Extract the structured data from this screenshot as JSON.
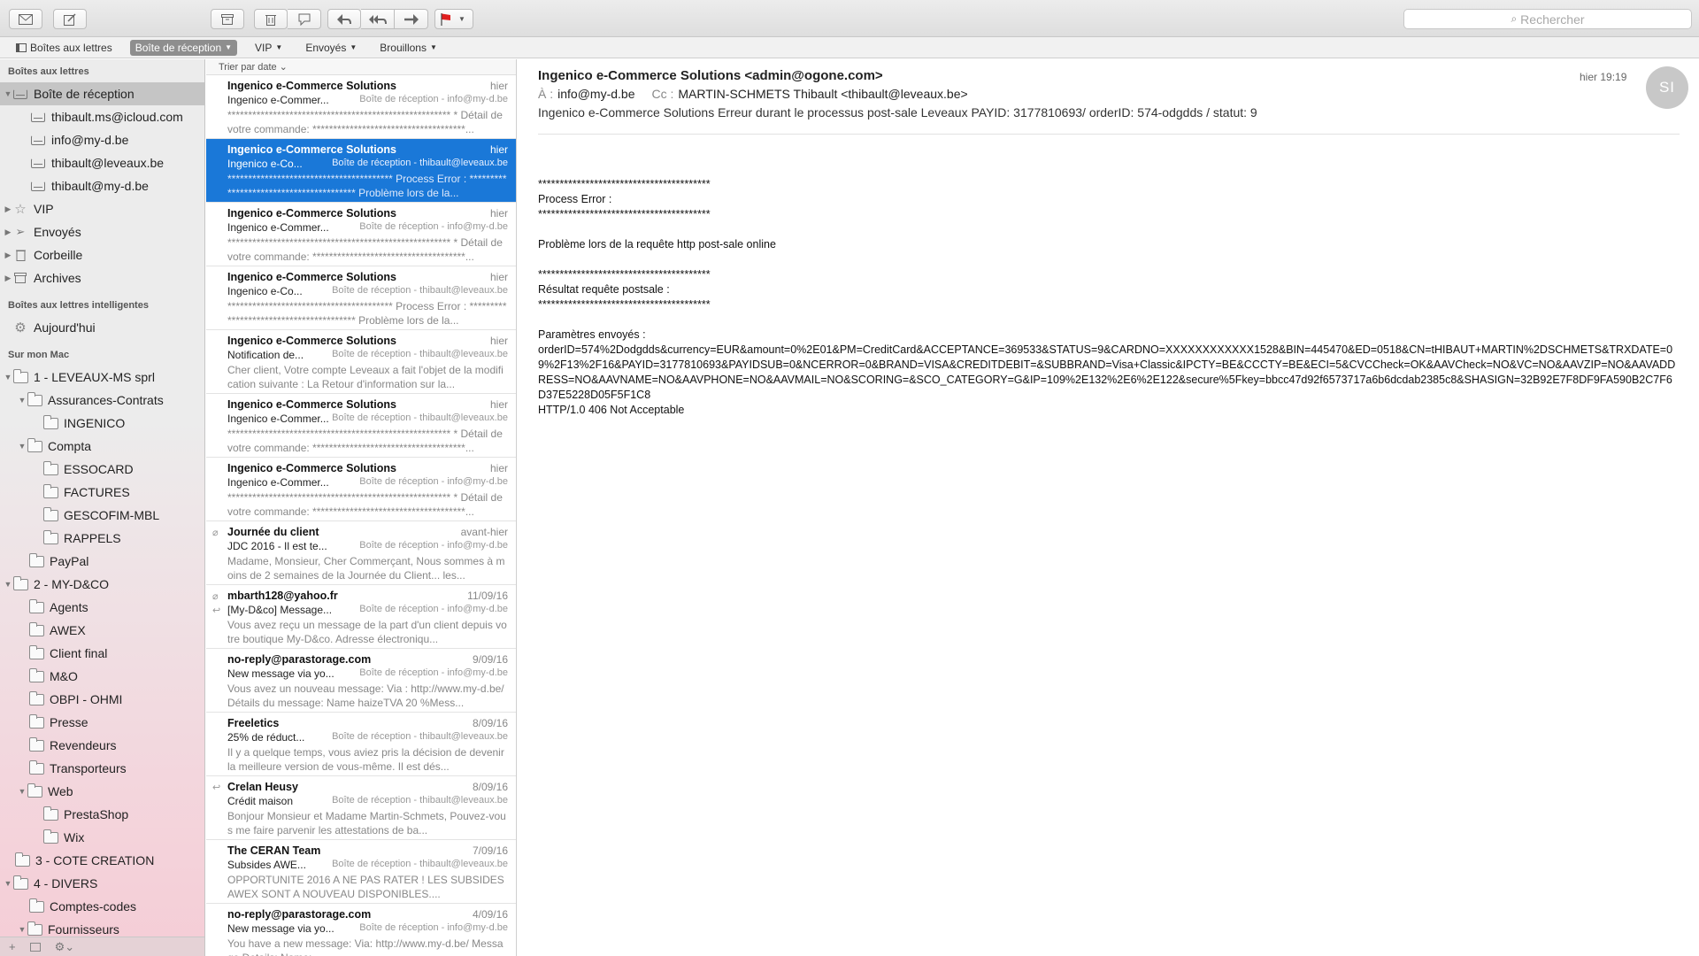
{
  "toolbar": {
    "buttons": [
      {
        "name": "get-mail",
        "icon": "envelope-icon"
      },
      {
        "name": "compose",
        "icon": "compose-icon"
      },
      {
        "name": "archive",
        "icon": "archive-icon"
      },
      {
        "name": "delete",
        "icon": "trash-icon"
      },
      {
        "name": "junk",
        "icon": "junk-icon"
      },
      {
        "name": "reply",
        "icon": "reply-icon"
      },
      {
        "name": "reply-all",
        "icon": "reply-all-icon"
      },
      {
        "name": "forward",
        "icon": "forward-icon"
      },
      {
        "name": "flag",
        "icon": "flag-icon"
      }
    ],
    "search_placeholder": "Rechercher",
    "flag_color": "#e02020"
  },
  "favorites": {
    "mailboxes": "Boîtes aux lettres",
    "inbox": "Boîte de réception",
    "vip": "VIP",
    "sent": "Envoyés",
    "drafts": "Brouillons"
  },
  "sidebar": {
    "section_mailboxes": "Boîtes aux lettres",
    "inbox": "Boîte de réception",
    "accounts": [
      "thibault.ms@icloud.com",
      "info@my-d.be",
      "thibault@leveaux.be",
      "thibault@my-d.be"
    ],
    "vip": "VIP",
    "sent": "Envoyés",
    "trash": "Corbeille",
    "archives": "Archives",
    "section_smart": "Boîtes aux lettres intelligentes",
    "today": "Aujourd'hui",
    "section_mac": "Sur mon Mac",
    "folders": {
      "f1": "1 - LEVEAUX-MS sprl",
      "assurances": "Assurances-Contrats",
      "ingenico": "INGENICO",
      "compta": "Compta",
      "essocard": "ESSOCARD",
      "factures": "FACTURES",
      "gescofim": "GESCOFIM-MBL",
      "rappels": "RAPPELS",
      "paypal": "PayPal",
      "f2": "2 - MY-D&CO",
      "agents": "Agents",
      "awex": "AWEX",
      "client_final": "Client final",
      "mo": "M&O",
      "obpi": "OBPI - OHMI",
      "presse": "Presse",
      "revendeurs": "Revendeurs",
      "transporteurs": "Transporteurs",
      "web": "Web",
      "prestashop": "PrestaShop",
      "wix": "Wix",
      "f3": "3 - COTE CREATION",
      "f4": "4 - DIVERS",
      "comptes_codes": "Comptes-codes",
      "fournisseurs": "Fournisseurs"
    },
    "bottom": {
      "add": "+",
      "gear": "⚙⌄"
    }
  },
  "list": {
    "sort_label": "Trier par date ⌄",
    "messages": [
      {
        "sender": "Ingenico e-Commerce Solutions",
        "date": "hier",
        "subject": "Ingenico e-Commer...",
        "mailbox": "Boîte de réception - info@my-d.be",
        "preview": "****************************************************** * Détail de votre commande: *************************************..."
      },
      {
        "sender": "Ingenico e-Commerce Solutions",
        "date": "hier",
        "subject": "Ingenico e-Co...",
        "mailbox": "Boîte de réception - thibault@leveaux.be",
        "preview": "**************************************** Process Error : **************************************** Problème lors de la..."
      },
      {
        "sender": "Ingenico e-Commerce Solutions",
        "date": "hier",
        "subject": "Ingenico e-Commer...",
        "mailbox": "Boîte de réception - info@my-d.be",
        "preview": "****************************************************** * Détail de votre commande: *************************************..."
      },
      {
        "sender": "Ingenico e-Commerce Solutions",
        "date": "hier",
        "subject": "Ingenico e-Co...",
        "mailbox": "Boîte de réception - thibault@leveaux.be",
        "preview": "**************************************** Process Error : **************************************** Problème lors de la..."
      },
      {
        "sender": "Ingenico e-Commerce Solutions",
        "date": "hier",
        "subject": "Notification de...",
        "mailbox": "Boîte de réception - thibault@leveaux.be",
        "preview": "Cher client, Votre compte Leveaux a fait l'objet de la modification suivante : La Retour d'information sur la..."
      },
      {
        "sender": "Ingenico e-Commerce Solutions",
        "date": "hier",
        "subject": "Ingenico e-Commer...",
        "mailbox": "Boîte de réception - thibault@leveaux.be",
        "preview": "****************************************************** * Détail de votre commande: *************************************..."
      },
      {
        "sender": "Ingenico e-Commerce Solutions",
        "date": "hier",
        "subject": "Ingenico e-Commer...",
        "mailbox": "Boîte de réception - info@my-d.be",
        "preview": "****************************************************** * Détail de votre commande: *************************************..."
      },
      {
        "sender": "Journée du client",
        "date": "avant-hier",
        "subject": "JDC 2016 - Il est te...",
        "mailbox": "Boîte de réception - info@my-d.be",
        "preview": "Madame, Monsieur, Cher Commerçant, Nous sommes à moins de 2 semaines de la Journée du Client... les..."
      },
      {
        "sender": "mbarth128@yahoo.fr",
        "date": "11/09/16",
        "subject": "[My-D&co] Message...",
        "mailbox": "Boîte de réception - info@my-d.be",
        "preview": "Vous avez reçu un message de la part d'un client depuis votre boutique My-D&co. Adresse électroniqu..."
      },
      {
        "sender": "no-reply@parastorage.com",
        "date": "9/09/16",
        "subject": "New message via yo...",
        "mailbox": "Boîte de réception - info@my-d.be",
        "preview": "Vous avez un nouveau message: Via : http://www.my-d.be/Détails du message: Name haizeTVA 20 %Mess..."
      },
      {
        "sender": "Freeletics",
        "date": "8/09/16",
        "subject": "25% de réduct...",
        "mailbox": "Boîte de réception - thibault@leveaux.be",
        "preview": "Il y a quelque temps, vous aviez pris la décision de devenir la meilleure version de vous-même. Il est dés..."
      },
      {
        "sender": "Crelan Heusy",
        "date": "8/09/16",
        "subject": "Crédit maison",
        "mailbox": "Boîte de réception - thibault@leveaux.be",
        "preview": "Bonjour Monsieur et Madame Martin-Schmets, Pouvez-vous me faire parvenir les attestations de ba..."
      },
      {
        "sender": "The CERAN Team",
        "date": "7/09/16",
        "subject": "Subsides AWE...",
        "mailbox": "Boîte de réception - thibault@leveaux.be",
        "preview": "OPPORTUNITE 2016 A NE PAS RATER ! LES SUBSIDES AWEX SONT A NOUVEAU DISPONIBLES...."
      },
      {
        "sender": "no-reply@parastorage.com",
        "date": "4/09/16",
        "subject": "New message via yo...",
        "mailbox": "Boîte de réception - info@my-d.be",
        "preview": "You have a new message: Via: http://www.my-d.be/ Message Details: Name: ..."
      }
    ]
  },
  "reader": {
    "from": "Ingenico e-Commerce Solutions <admin@ogone.com>",
    "to_label": "À :",
    "to": "info@my-d.be",
    "cc_label": "Cc :",
    "cc": "MARTIN-SCHMETS Thibault <thibault@leveaux.be>",
    "subject": "Ingenico e-Commerce Solutions Erreur durant le processus post-sale Leveaux PAYID: 3177810693/ orderID: 574-odgdds / statut: 9",
    "time": "hier 19:19",
    "avatar_initials": "SI",
    "body": [
      "****************************************",
      "Process Error :",
      "****************************************",
      "",
      "Problème lors de la requête http post-sale online",
      "",
      "****************************************",
      "Résultat requête postsale :",
      "****************************************",
      "",
      "Paramètres envoyés :",
      "orderID=574%2Dodgdds&currency=EUR&amount=0%2E01&PM=CreditCard&ACCEPTANCE=369533&STATUS=9&CARDNO=XXXXXXXXXXXX1528&BIN=445470&ED=0518&CN=tHIBAUT+MARTIN%2DSCHMETS&TRXDATE=09%2F13%2F16&PAYID=3177810693&PAYIDSUB=0&NCERROR=0&BRAND=VISA&CREDITDEBIT=&SUBBRAND=Visa+Classic&IPCTY=BE&CCCTY=BE&ECI=5&CVCCheck=OK&AAVCheck=NO&VC=NO&AAVZIP=NO&AAVADDRESS=NO&AAVNAME=NO&AAVPHONE=NO&AAVMAIL=NO&SCORING=&SCO_CATEGORY=G&IP=109%2E132%2E6%2E122&secure%5Fkey=bbcc47d92f6573717a6b6dcdab2385c8&SHASIGN=32B92E7F8DF9FA590B2C7F6D37E5228D05F5F1C8",
      "HTTP/1.0 406 Not Acceptable"
    ]
  }
}
